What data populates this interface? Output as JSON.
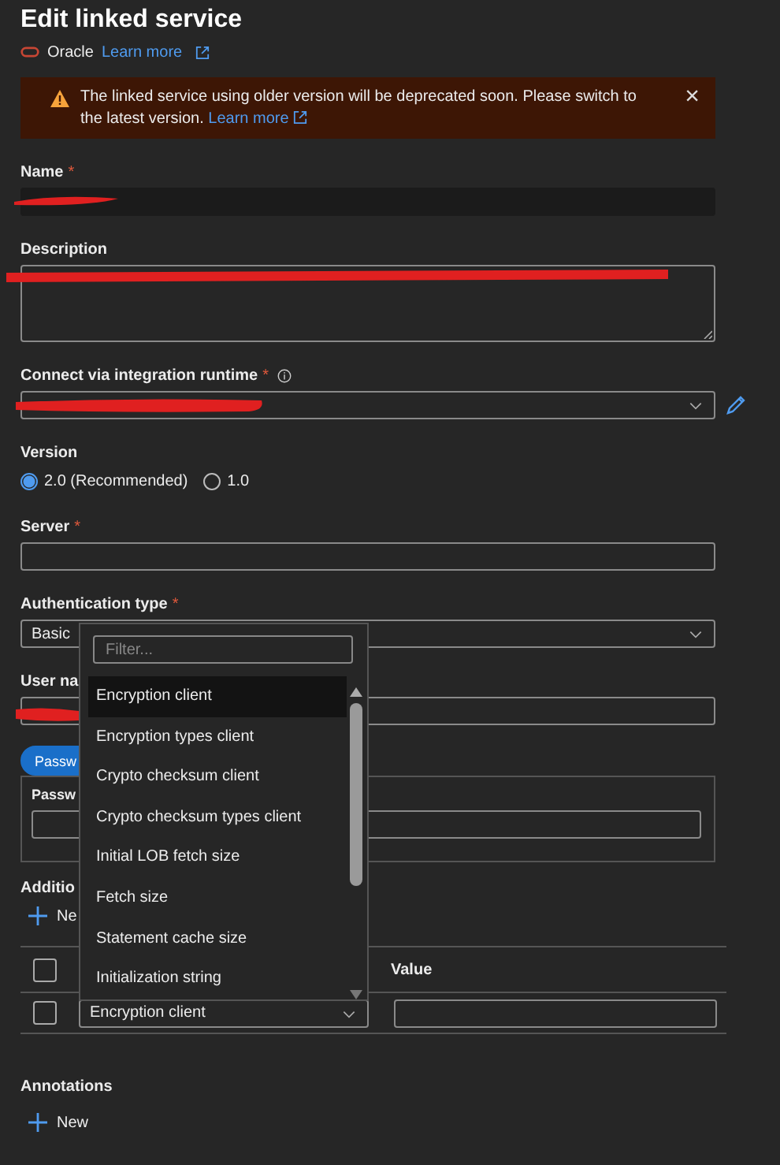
{
  "title": "Edit linked service",
  "subtitle": {
    "service": "Oracle",
    "link": "Learn more"
  },
  "banner": {
    "message": "The linked service using older version will be deprecated soon. Please switch to the latest version.",
    "link": "Learn more",
    "close": "×"
  },
  "name": {
    "label": "Name",
    "required": "*",
    "redacted": true
  },
  "description": {
    "label": "Description",
    "redacted": true
  },
  "runtime": {
    "label": "Connect via integration runtime",
    "required": "*",
    "redacted": true
  },
  "version": {
    "label": "Version",
    "options": [
      {
        "label": "2.0 (Recommended)",
        "selected": true
      },
      {
        "label": "1.0",
        "selected": false
      }
    ]
  },
  "server": {
    "label": "Server",
    "required": "*"
  },
  "auth": {
    "label": "Authentication type",
    "required": "*",
    "value": "Basic"
  },
  "username": {
    "label": "User na",
    "redacted": true
  },
  "password_toggle": {
    "label": "Passw",
    "selected": true
  },
  "password": {
    "label": "Passw"
  },
  "additional": {
    "label": "Additio",
    "new": "Ne"
  },
  "table": {
    "header": {
      "checked": false,
      "value": "Value"
    },
    "rows": [
      {
        "checked": false,
        "property": "Encryption client"
      }
    ]
  },
  "annotations": {
    "label": "Annotations",
    "new": "New"
  },
  "dropdown": {
    "placeholder": "Filter...",
    "items": [
      {
        "label": "Encryption client",
        "selected": true
      },
      {
        "label": "Encryption types client",
        "selected": false
      },
      {
        "label": "Crypto checksum client",
        "selected": false
      },
      {
        "label": "Crypto checksum types client",
        "selected": false
      },
      {
        "label": "Initial LOB fetch size",
        "selected": false
      },
      {
        "label": "Fetch size",
        "selected": false
      },
      {
        "label": "Statement cache size",
        "selected": false
      },
      {
        "label": "Initialization string",
        "selected": false
      }
    ]
  }
}
